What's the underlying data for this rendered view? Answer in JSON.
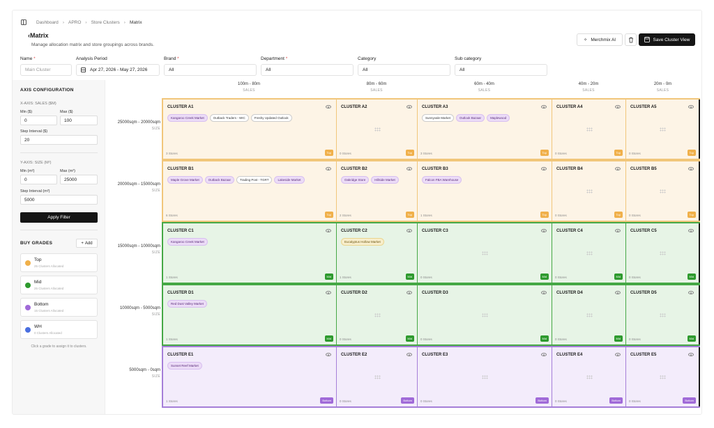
{
  "breadcrumb": [
    "Dashboard",
    "APRO",
    "Store Clusters",
    "Matrix"
  ],
  "page_title": "Matrix",
  "page_subtitle": "Manage allocation matrix and store groupings across brands.",
  "buttons": {
    "merchmix": "Merchmix AI",
    "save": "Save Cluster View",
    "apply": "Apply Filter",
    "add": "Add"
  },
  "filters": {
    "name": {
      "label": "Name",
      "placeholder": "Main Cluster"
    },
    "period": {
      "label": "Analysis Period",
      "value": "Apr 27, 2026 - May 27, 2026"
    },
    "brand": {
      "label": "Brand",
      "value": "All"
    },
    "department": {
      "label": "Department",
      "value": "All"
    },
    "category": {
      "label": "Category",
      "value": "All"
    },
    "subcategory": {
      "label": "Sub category",
      "value": "All"
    }
  },
  "axis": {
    "heading": "AXIS CONFIGURATION",
    "x_title": "X-AXIS: SALES ($M)",
    "x_min_label": "Min ($)",
    "x_min": "0",
    "x_max_label": "Max ($)",
    "x_max": "100",
    "x_step_label": "Step Interval ($)",
    "x_step": "20",
    "y_title": "Y-AXIS: SIZE (M²)",
    "y_min_label": "Min (m²)",
    "y_min": "0",
    "y_max_label": "Max (m²)",
    "y_max": "25000",
    "y_step_label": "Step Interval (m²)",
    "y_step": "5000"
  },
  "grades_heading": "BUY GRADES",
  "grades": [
    {
      "name": "Top",
      "count": "25 Clusters Allocated",
      "color": "#f0b04a"
    },
    {
      "name": "Mid",
      "count": "25 Clusters Allocated",
      "color": "#2e9a2e"
    },
    {
      "name": "Bottom",
      "count": "15 Clusters Allocated",
      "color": "#a06ad8"
    },
    {
      "name": "WH",
      "count": "0 Clusters Allocated",
      "color": "#4a6fe0"
    }
  ],
  "grade_hint": "Click a grade to assign it to clusters.",
  "columns": [
    {
      "range": "100m - 80m",
      "label": "SALES"
    },
    {
      "range": "80m - 60m",
      "label": "SALES"
    },
    {
      "range": "60m - 40m",
      "label": "SALES"
    },
    {
      "range": "40m - 20m",
      "label": "SALES"
    },
    {
      "range": "20m - 0m",
      "label": "SALES"
    }
  ],
  "rows": [
    {
      "range": "25000sqm - 20000sqm",
      "label": "SIZE",
      "grade": "Top",
      "cells": [
        {
          "name": "CLUSTER A1",
          "stores": "3 Stores",
          "chips": [
            [
              "Kangaroo Creek Market",
              "p"
            ],
            [
              "Outback Traders - WIC",
              "w"
            ],
            [
              "Freshy Updated Outlook",
              "w"
            ]
          ]
        },
        {
          "name": "CLUSTER A2",
          "stores": "0 Stores",
          "chips": []
        },
        {
          "name": "CLUSTER A3",
          "stores": "3 Stores",
          "chips": [
            [
              "Sunnyvale Market",
              "w"
            ],
            [
              "Outlook Bazaar",
              "p"
            ],
            [
              "Maplewood",
              "p"
            ]
          ]
        },
        {
          "name": "CLUSTER A4",
          "stores": "0 Stores",
          "chips": []
        },
        {
          "name": "CLUSTER A5",
          "stores": "0 Stores",
          "chips": []
        }
      ]
    },
    {
      "range": "20000sqm - 15000sqm",
      "label": "SIZE",
      "grade": "Top",
      "cells": [
        {
          "name": "CLUSTER B1",
          "stores": "6 Stores",
          "chips": [
            [
              "Maple Grove Market",
              "p"
            ],
            [
              "Outback Bazaar",
              "p"
            ],
            [
              "Trading Post - TGRT",
              "w"
            ],
            [
              "Lakeside Market",
              "p"
            ]
          ]
        },
        {
          "name": "CLUSTER B2",
          "stores": "2 Stores",
          "chips": [
            [
              "Oakridge Store",
              "p"
            ],
            [
              "Hillside Market",
              "p"
            ]
          ]
        },
        {
          "name": "CLUSTER B3",
          "stores": "1 Stores",
          "chips": [
            [
              "Falcon FBA Warehouse",
              "p"
            ]
          ]
        },
        {
          "name": "CLUSTER B4",
          "stores": "0 Stores",
          "chips": []
        },
        {
          "name": "CLUSTER B5",
          "stores": "0 Stores",
          "chips": []
        }
      ]
    },
    {
      "range": "15000sqm - 10000sqm",
      "label": "SIZE",
      "grade": "Mid",
      "cells": [
        {
          "name": "CLUSTER C1",
          "stores": "1 Stores",
          "chips": [
            [
              "Kangaroo Creek Market",
              "p"
            ]
          ]
        },
        {
          "name": "CLUSTER C2",
          "stores": "1 Stores",
          "chips": [
            [
              "Eucalyptus Hollow Market",
              "y"
            ]
          ]
        },
        {
          "name": "CLUSTER C3",
          "stores": "0 Stores",
          "chips": []
        },
        {
          "name": "CLUSTER C4",
          "stores": "0 Stores",
          "chips": []
        },
        {
          "name": "CLUSTER C5",
          "stores": "0 Stores",
          "chips": []
        }
      ]
    },
    {
      "range": "10000sqm - 5000sqm",
      "label": "SIZE",
      "grade": "Mid",
      "cells": [
        {
          "name": "CLUSTER D1",
          "stores": "1 Stores",
          "chips": [
            [
              "Red Dust Valley Market",
              "p"
            ]
          ]
        },
        {
          "name": "CLUSTER D2",
          "stores": "0 Stores",
          "chips": []
        },
        {
          "name": "CLUSTER D3",
          "stores": "0 Stores",
          "chips": []
        },
        {
          "name": "CLUSTER D4",
          "stores": "0 Stores",
          "chips": []
        },
        {
          "name": "CLUSTER D5",
          "stores": "0 Stores",
          "chips": []
        }
      ]
    },
    {
      "range": "5000sqm - 0sqm",
      "label": "SIZE",
      "grade": "Bottom",
      "cells": [
        {
          "name": "CLUSTER E1",
          "stores": "1 Stores",
          "chips": [
            [
              "Sunset Reef Market",
              "p"
            ]
          ]
        },
        {
          "name": "CLUSTER E2",
          "stores": "0 Stores",
          "chips": []
        },
        {
          "name": "CLUSTER E3",
          "stores": "0 Stores",
          "chips": []
        },
        {
          "name": "CLUSTER E4",
          "stores": "0 Stores",
          "chips": []
        },
        {
          "name": "CLUSTER E5",
          "stores": "0 Stores",
          "chips": []
        }
      ]
    }
  ]
}
